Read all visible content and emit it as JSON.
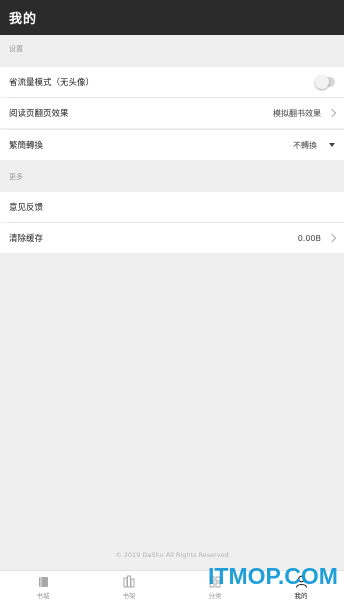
{
  "header": {
    "title": "我的"
  },
  "sections": {
    "settings_title": "设置",
    "more_title": "更多"
  },
  "settings": {
    "data_saver_label": "省流量模式（无头像）",
    "data_saver_enabled": false,
    "page_turn_label": "阅读页翻页效果",
    "page_turn_value": "模拟翻书效果",
    "script_label": "繁簡轉換",
    "script_value": "不轉換"
  },
  "more": {
    "feedback_label": "意见反馈",
    "clear_cache_label": "清除缓存",
    "cache_size": "0.00B"
  },
  "footer": {
    "copyright": "© 2019 DaShu All Rights Reserved"
  },
  "tabs": [
    {
      "label": "书城",
      "icon": "book-icon"
    },
    {
      "label": "书架",
      "icon": "bookshelf-icon"
    },
    {
      "label": "分类",
      "icon": "category-icon"
    },
    {
      "label": "我的",
      "icon": "user-icon"
    }
  ],
  "watermark": "ITMOP.COM",
  "colors": {
    "topbar": "#2b2b2b",
    "background": "#efefef",
    "watermark": "#159ad8"
  }
}
